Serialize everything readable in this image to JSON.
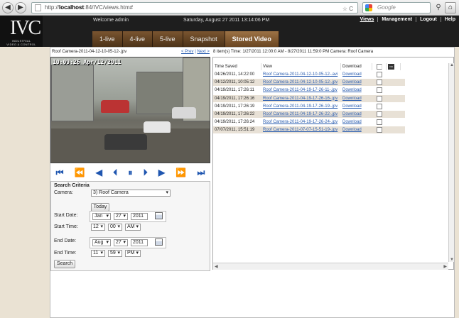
{
  "browser": {
    "back": "◀",
    "forward": "▶",
    "url_prefix": "http://",
    "url_host": "localhost",
    "url_rest": ":84/IVC/views.htm#",
    "search_placeholder": "Google",
    "star": "☆",
    "reload": "C",
    "search_go": "⚲",
    "home": "⌂"
  },
  "header": {
    "logo_big": "IVC",
    "logo_small_1": "INDUSTRIAL",
    "logo_small_2": "VIDEO & CONTROL",
    "welcome": "Welcome admin",
    "datetime": "Saturday, August 27 2011 13:14:06 PM",
    "menu": [
      "Views",
      "Management",
      "Logout",
      "Help"
    ],
    "tabs": [
      "1-live",
      "4-live",
      "5-live",
      "Snapshot",
      "Stored Video"
    ],
    "active_tab": "Stored Video"
  },
  "player": {
    "file_title": "Roof Camera-2011-04-12-10-05-12-.jpv",
    "prev": "< Prev",
    "sep": "|",
    "next": "Next >",
    "timestamp": "10:09:26 Apr/12/2011",
    "controls": [
      "⏮",
      "⏪",
      "◀",
      "⏴",
      "⏸",
      "⏵",
      "▶",
      "⏩",
      "⏭"
    ]
  },
  "criteria": {
    "title": "Search Criteria",
    "camera_label": "Camera:",
    "camera_value": "3) Roof Camera",
    "today_button": "Today",
    "start_date_label": "Start Date:",
    "start_month": "Jan",
    "start_day": "27",
    "start_year": "2011",
    "start_time_label": "Start Time:",
    "start_hour": "12",
    "start_min": "00",
    "start_ampm": "AM",
    "end_date_label": "End Date:",
    "end_month": "Aug",
    "end_day": "27",
    "end_year": "2011",
    "end_time_label": "End Time:",
    "end_hour": "11",
    "end_min": "59",
    "end_ampm": "PM",
    "search_button": "Search"
  },
  "results": {
    "summary": "8 item(s) Time: 1/27/2011 12:00:0 AM - 8/27/2011 11:59:0 PM Camera: Roof Camera",
    "headers": {
      "time": "Time Saved",
      "view": "View",
      "download": "Download",
      "video_icon": "VID"
    },
    "rows": [
      {
        "time": "04/26/2011, 14:22:00",
        "view": "Roof Camera-2011-04-12-10-05-12-.avi",
        "download": "Download"
      },
      {
        "time": "04/12/2011, 10:05:12",
        "view": "Roof Camera-2011-04-12-10-05-12-.jpv",
        "download": "Download"
      },
      {
        "time": "04/19/2011, 17:26:11",
        "view": "Roof Camera-2011-04-19-17-26-11-.jpv",
        "download": "Download"
      },
      {
        "time": "04/19/2011, 17:26:16",
        "view": "Roof Camera-2011-04-19-17-26-16-.jpv",
        "download": "Download"
      },
      {
        "time": "04/19/2011, 17:26:19",
        "view": "Roof Camera-2011-04-19-17-26-19-.jpv",
        "download": "Download"
      },
      {
        "time": "04/19/2011, 17:26:22",
        "view": "Roof Camera-2011-04-19-17-26-22-.jpv",
        "download": "Download"
      },
      {
        "time": "04/19/2011, 17:26:24",
        "view": "Roof Camera-2011-04-19-17-26-24-.jpv",
        "download": "Download"
      },
      {
        "time": "07/07/2011, 15:51:19",
        "view": "Roof Camera-2011-07-07-15-51-19-.jpv",
        "download": "Download"
      }
    ]
  }
}
